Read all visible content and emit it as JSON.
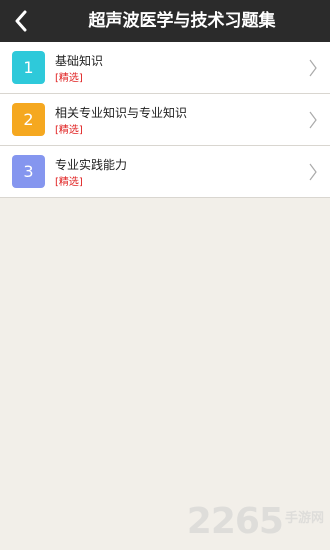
{
  "header": {
    "title": "超声波医学与技术习题集",
    "back_icon": "chevron-left-icon"
  },
  "items": [
    {
      "num": "1",
      "title": "基础知识",
      "tag": "[精选]",
      "color": "#2ec9da"
    },
    {
      "num": "2",
      "title": "相关专业知识与专业知识",
      "tag": "[精选]",
      "color": "#f5a820"
    },
    {
      "num": "3",
      "title": "专业实践能力",
      "tag": "[精选]",
      "color": "#8596ef"
    }
  ],
  "watermark": {
    "digits": "2265",
    "text": "手游网"
  },
  "colors": {
    "header_bg": "#2b2b2b",
    "page_bg": "#f2efe9",
    "tag_red": "#e02020"
  }
}
